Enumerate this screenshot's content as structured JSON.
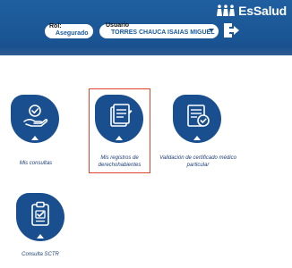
{
  "header": {
    "logo_text": "EsSalud",
    "rol": {
      "label": "Rol:",
      "value": "Asegurado"
    },
    "usuario": {
      "label": "Usuario",
      "value": "TORRES CHAUCA ISAIAS MIGUEL"
    },
    "logout_icon": "logout-icon"
  },
  "tiles": [
    {
      "label": "Mis consultas",
      "icon": "hand-check-icon"
    },
    {
      "label": "Mis registros de derechohabientes",
      "icon": "documents-icon",
      "selected": true
    },
    {
      "label": "Validación de certificado médico particular",
      "icon": "certificate-check-icon"
    },
    {
      "label": "Consulta SCTR",
      "icon": "clipboard-check-icon"
    }
  ],
  "colors": {
    "header_blue": "#1a5594",
    "tile_blue": "#1a4f8f",
    "label_blue": "#1d3f78",
    "selection_red": "#e0442c"
  }
}
